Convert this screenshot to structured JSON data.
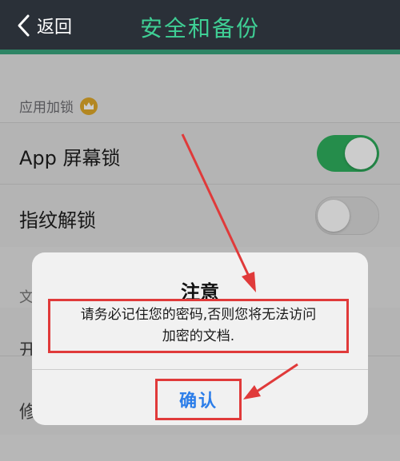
{
  "navbar": {
    "back_label": "返回",
    "title": "安全和备份"
  },
  "section_app_lock": {
    "header": "应用加锁",
    "premium_icon": "crown-icon"
  },
  "rows": [
    {
      "label": "App 屏幕锁",
      "toggle": "on"
    },
    {
      "label": "指纹解锁",
      "toggle": "off"
    }
  ],
  "partially_visible": {
    "section_char": "文",
    "row1_char": "开",
    "row2_char": "修"
  },
  "dialog": {
    "title": "注意",
    "message_line1": "请务必记住您的密码,否则您将无法访问",
    "message_line2": "加密的文档.",
    "confirm_label": "确认"
  },
  "colors": {
    "navbar_bg": "#2a3038",
    "title_green": "#3fcf95",
    "toggle_on": "#2fb15e",
    "annotation_red": "#e03a3a",
    "confirm_blue": "#2b7de9"
  }
}
